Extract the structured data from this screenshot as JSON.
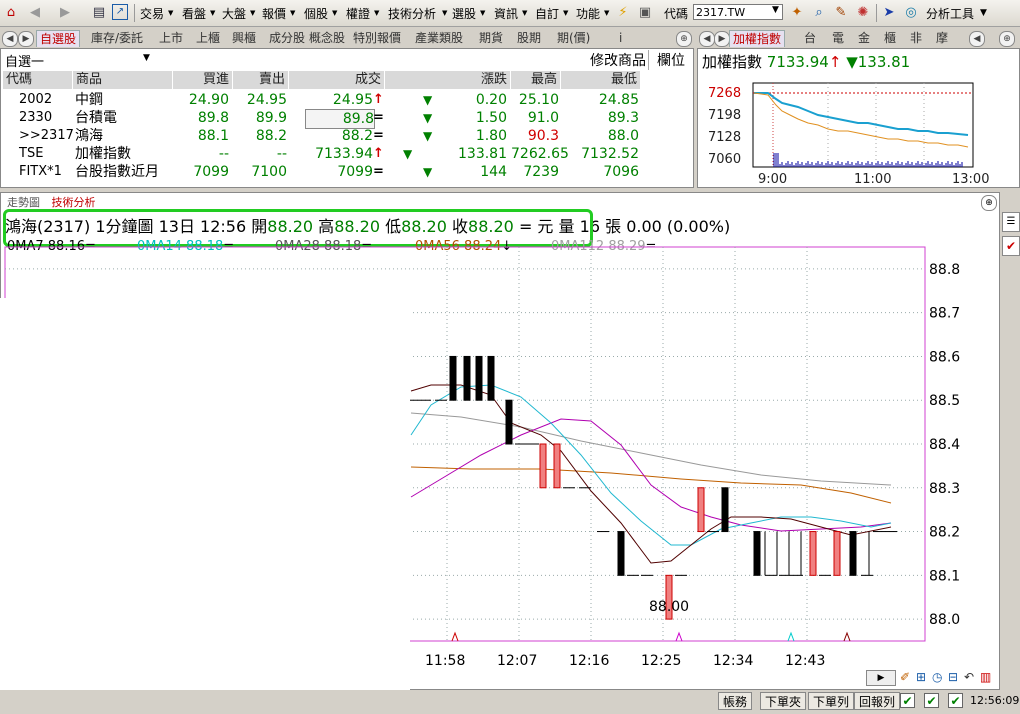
{
  "toolbar": {
    "menus": [
      "交易",
      "看盤",
      "大盤",
      "報價",
      "個股",
      "權證",
      "技術分析",
      "選股",
      "資訊",
      "自訂",
      "功能"
    ],
    "code_label": "代碼",
    "code_value": "2317.TW",
    "analysis_tool": "分析工具"
  },
  "quote_tabs": [
    "自選股",
    "庫存/委託",
    "上市",
    "上櫃",
    "興櫃",
    "成分股",
    "概念股",
    "特別報價",
    "產業類股",
    "期貨",
    "股期",
    "期(價)",
    "i"
  ],
  "watchlist": {
    "name": "自選一",
    "modify": "修改商品",
    "columns_label": "欄位",
    "headers": [
      "代碼",
      "商品",
      "買進",
      "賣出",
      "成交",
      "漲跌",
      "最高",
      "最低"
    ],
    "rows": [
      {
        "code": "2002",
        "name": "中鋼",
        "bid": "24.90",
        "ask": "24.95",
        "last": "24.95",
        "last_mark": "↑",
        "change": "0.20",
        "high": "25.10",
        "low": "24.85",
        "high_red": false
      },
      {
        "code": "2330",
        "name": "台積電",
        "bid": "89.8",
        "ask": "89.9",
        "last": "89.8",
        "last_mark": "=",
        "change": "1.50",
        "high": "91.0",
        "low": "89.3",
        "high_red": false
      },
      {
        "code": ">>2317",
        "name": "鴻海",
        "bid": "88.1",
        "ask": "88.2",
        "last": "88.2",
        "last_mark": "=",
        "change": "1.80",
        "high": "90.3",
        "low": "88.0",
        "high_red": true
      },
      {
        "code": "TSE",
        "name": "加權指數",
        "bid": "--",
        "ask": "--",
        "last": "7133.94",
        "last_mark": "↑",
        "change": "133.81",
        "high": "7262.65",
        "low": "7132.52",
        "high_red": false
      },
      {
        "code": "FITX*1",
        "name": "台股指數近月",
        "bid": "7099",
        "ask": "7100",
        "last": "7099",
        "last_mark": "=",
        "change": "144",
        "high": "7239",
        "low": "7096",
        "high_red": false
      }
    ]
  },
  "index_tabs": [
    "加權指數",
    "台",
    "電",
    "金",
    "櫃",
    "非",
    "摩"
  ],
  "index": {
    "name": "加權指數",
    "value": "7133.94",
    "up_mark": "↑",
    "change": "133.81",
    "y_labels": [
      "7268",
      "7198",
      "7128",
      "7060"
    ],
    "x_labels": [
      "9:00",
      "11:00",
      "13:00"
    ]
  },
  "chart_tabs": [
    "走勢圖",
    "技術分析"
  ],
  "chart_info": {
    "title": "鴻海(2317)",
    "period": "1分鐘圖",
    "datetime": "13日 12:56",
    "open_label": "開",
    "open": "88.20",
    "high_label": "高",
    "high": "88.20",
    "low_label": "低",
    "low": "88.20",
    "close_label": "收",
    "close": "88.20",
    "eq": "= 元",
    "vol_label": "量",
    "vol": "16 張",
    "chg": "0.00 (0.00%)"
  },
  "ma_legend": [
    {
      "label": "0MA7 88.16",
      "mark": "=",
      "color": "#000000"
    },
    {
      "label": "0MA14 88.18",
      "mark": "=",
      "color": "#00c0c0"
    },
    {
      "label": "0MA28 88.18",
      "mark": "=",
      "color": "#555555"
    },
    {
      "label": "0MA56 88.24",
      "mark": "↓",
      "color": "#b05000"
    },
    {
      "label": "0MA112 88.29",
      "mark": "=",
      "color": "#a0a0a0"
    }
  ],
  "chart_data": {
    "type": "candlestick",
    "ylim": [
      87.95,
      88.85
    ],
    "y_ticks": [
      "88.8",
      "88.7",
      "88.6",
      "88.5",
      "88.4",
      "88.3",
      "88.2",
      "88.1",
      "88.0"
    ],
    "x_ticks": [
      "11:58",
      "12:07",
      "12:16",
      "12:25",
      "12:34",
      "12:43"
    ],
    "min_annotation": "88.00"
  },
  "status": {
    "buttons": [
      "帳務",
      "下單夾",
      "下單列",
      "回報列"
    ],
    "time": "12:56:09"
  }
}
